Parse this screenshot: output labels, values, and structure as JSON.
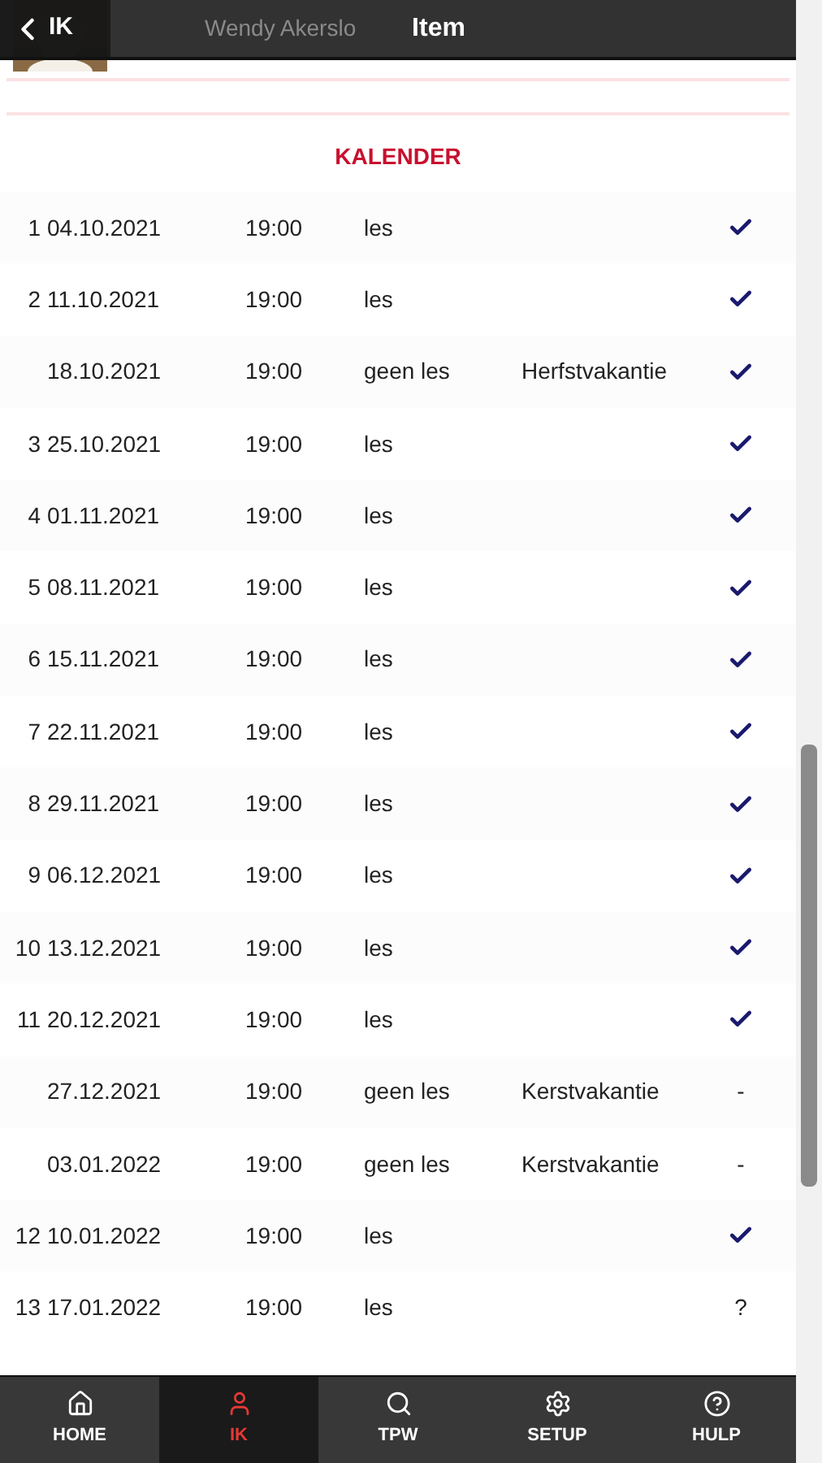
{
  "header": {
    "back_label": "IK",
    "title": "Item"
  },
  "profile": {
    "name": "Wendy Akerslo"
  },
  "section_title": "KALENDER",
  "rows": [
    {
      "number": "1",
      "date": "04.10.2021",
      "time": "19:00",
      "type": "les",
      "status": {
        "kind": "check"
      }
    },
    {
      "number": "2",
      "date": "11.10.2021",
      "time": "19:00",
      "type": "les",
      "status": {
        "kind": "check"
      }
    },
    {
      "date": "18.10.2021",
      "time": "19:00",
      "type": "geen les",
      "note": "Herfstvakantie",
      "status": {
        "kind": "check"
      }
    },
    {
      "number": "3",
      "date": "25.10.2021",
      "time": "19:00",
      "type": "les",
      "status": {
        "kind": "check"
      }
    },
    {
      "number": "4",
      "date": "01.11.2021",
      "time": "19:00",
      "type": "les",
      "status": {
        "kind": "check"
      }
    },
    {
      "number": "5",
      "date": "08.11.2021",
      "time": "19:00",
      "type": "les",
      "status": {
        "kind": "check"
      }
    },
    {
      "number": "6",
      "date": "15.11.2021",
      "time": "19:00",
      "type": "les",
      "status": {
        "kind": "check"
      }
    },
    {
      "number": "7",
      "date": "22.11.2021",
      "time": "19:00",
      "type": "les",
      "status": {
        "kind": "check"
      }
    },
    {
      "number": "8",
      "date": "29.11.2021",
      "time": "19:00",
      "type": "les",
      "status": {
        "kind": "check"
      }
    },
    {
      "number": "9",
      "date": "06.12.2021",
      "time": "19:00",
      "type": "les",
      "status": {
        "kind": "check"
      }
    },
    {
      "number": "10",
      "date": "13.12.2021",
      "time": "19:00",
      "type": "les",
      "status": {
        "kind": "check"
      }
    },
    {
      "number": "11",
      "date": "20.12.2021",
      "time": "19:00",
      "type": "les",
      "status": {
        "kind": "check"
      }
    },
    {
      "date": "27.12.2021",
      "time": "19:00",
      "type": "geen les",
      "note": "Kerstvakantie",
      "status": {
        "kind": "text",
        "text": "-"
      }
    },
    {
      "date": "03.01.2022",
      "time": "19:00",
      "type": "geen les",
      "note": "Kerstvakantie",
      "status": {
        "kind": "text",
        "text": "-"
      }
    },
    {
      "number": "12",
      "date": "10.01.2022",
      "time": "19:00",
      "type": "les",
      "status": {
        "kind": "check"
      }
    },
    {
      "number": "13",
      "date": "17.01.2022",
      "time": "19:00",
      "type": "les",
      "status": {
        "kind": "text",
        "text": "?"
      }
    }
  ],
  "nav": [
    {
      "kind": "home",
      "label": "HOME",
      "selected": false
    },
    {
      "kind": "user",
      "label": "IK",
      "selected": true
    },
    {
      "kind": "search",
      "label": "TPW",
      "selected": false
    },
    {
      "kind": "settings",
      "label": "SETUP",
      "selected": false
    },
    {
      "kind": "help",
      "label": "HULP",
      "selected": false
    }
  ]
}
